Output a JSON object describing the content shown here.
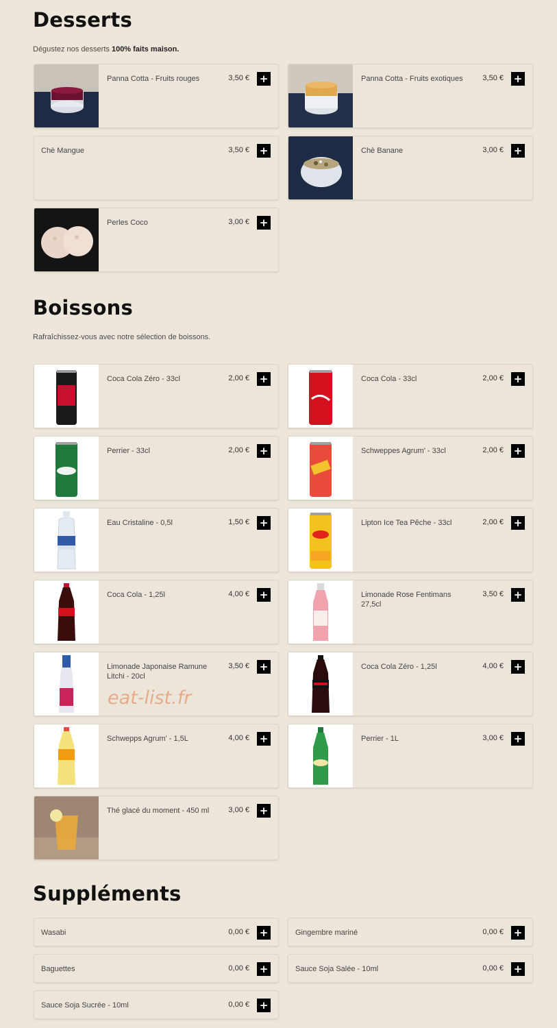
{
  "sections": {
    "desserts": {
      "title": "Desserts",
      "desc_prefix": "Dégustez nos desserts ",
      "desc_bold": "100% faits maison."
    },
    "boissons": {
      "title": "Boissons",
      "desc": "Rafraîchissez-vous avec notre sélection de boissons."
    },
    "supplements": {
      "title": "Suppléments"
    }
  },
  "add_label": "+",
  "watermark": "eat-list.fr",
  "desserts": [
    {
      "name": "Panna Cotta - Fruits rouges",
      "price": "3,50 €",
      "image": "panna-cotta-red-photo"
    },
    {
      "name": "Panna Cotta - Fruits exotiques",
      "price": "3,50 €",
      "image": "panna-cotta-exotic-photo"
    },
    {
      "name": "Chè Mangue",
      "price": "3,50 €"
    },
    {
      "name": "Chè Banane",
      "price": "3,00 €",
      "image": "che-banane-photo"
    },
    {
      "name": "Perles Coco",
      "price": "3,00 €",
      "image": "perles-coco-photo"
    }
  ],
  "boissons": [
    {
      "name": "Coca Cola Zéro - 33cl",
      "price": "2,00 €",
      "image": "coke-zero-can-photo"
    },
    {
      "name": "Coca Cola - 33cl",
      "price": "2,00 €",
      "image": "coke-can-photo"
    },
    {
      "name": "Perrier - 33cl",
      "price": "2,00 €",
      "image": "perrier-can-photo"
    },
    {
      "name": "Schweppes Agrum' - 33cl",
      "price": "2,00 €",
      "image": "schweppes-can-photo"
    },
    {
      "name": "Eau Cristaline - 0,5l",
      "price": "1,50 €",
      "image": "water-bottle-photo"
    },
    {
      "name": "Lipton Ice Tea Pêche - 33cl",
      "price": "2,00 €",
      "image": "lipton-can-photo"
    },
    {
      "name": "Coca Cola - 1,25l",
      "price": "4,00 €",
      "image": "coke-bottle-photo"
    },
    {
      "name": "Limonade Rose Fentimans 27,5cl",
      "price": "3,50 €",
      "image": "fentimans-bottle-photo"
    },
    {
      "name": "Limonade Japonaise Ramune Litchi - 20cl",
      "price": "3,50 €",
      "image": "ramune-bottle-photo"
    },
    {
      "name": "Coca Cola Zéro - 1,25l",
      "price": "4,00 €",
      "image": "coke-zero-bottle-photo"
    },
    {
      "name": "Schwepps Agrum' - 1,5L",
      "price": "4,00 €",
      "image": "schweppes-bottle-photo"
    },
    {
      "name": "Perrier - 1L",
      "price": "3,00 €",
      "image": "perrier-bottle-photo"
    },
    {
      "name": "Thé glacé du moment - 450 ml",
      "price": "3,00 €",
      "image": "iced-tea-glass-photo"
    }
  ],
  "supplements": [
    {
      "name": "Wasabi",
      "price": "0,00 €"
    },
    {
      "name": "Gingembre mariné",
      "price": "0,00 €"
    },
    {
      "name": "Baguettes",
      "price": "0,00 €"
    },
    {
      "name": "Sauce Soja Salée - 10ml",
      "price": "0,00 €"
    },
    {
      "name": "Sauce Soja Sucrée - 10ml",
      "price": "0,00 €"
    }
  ]
}
